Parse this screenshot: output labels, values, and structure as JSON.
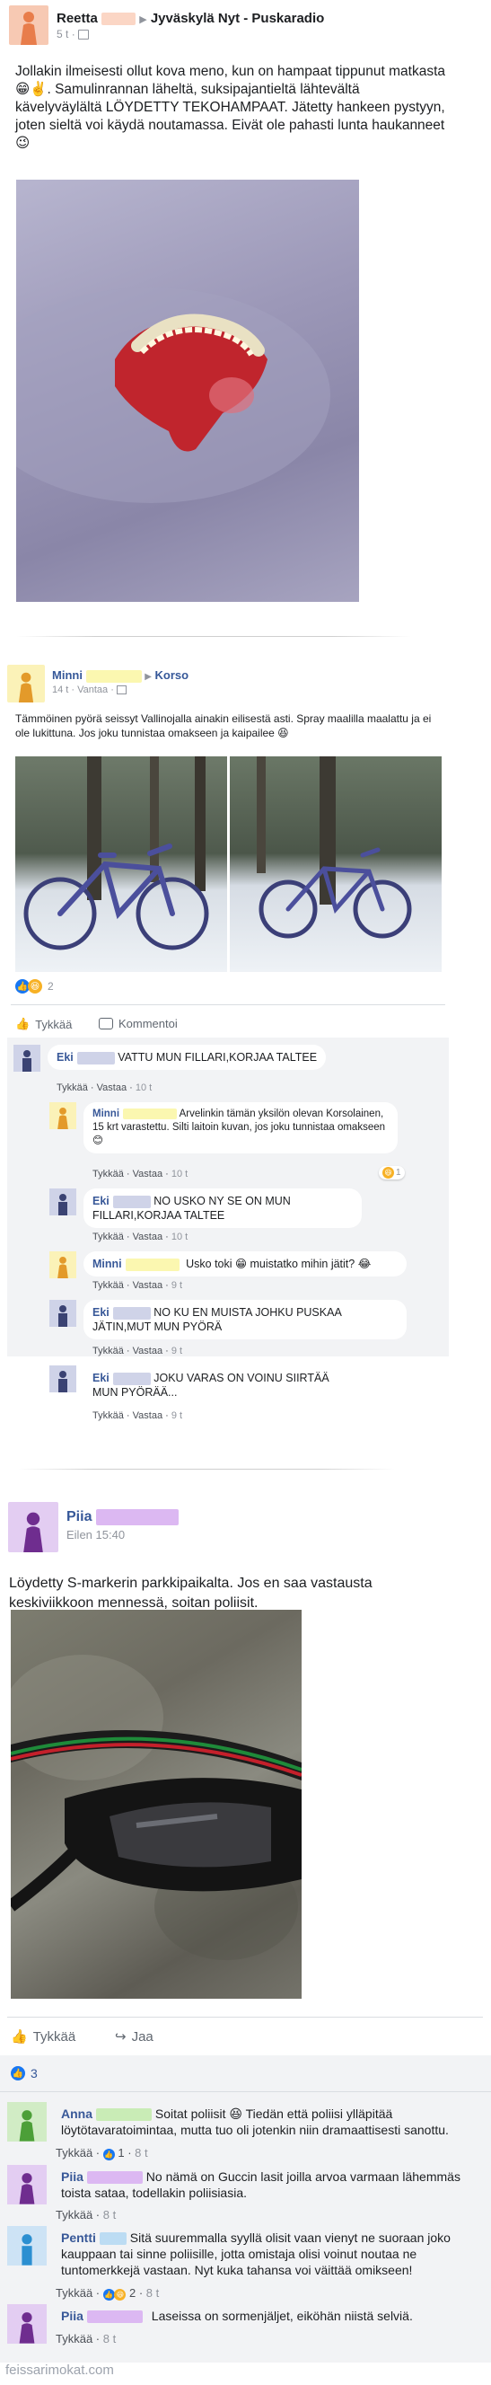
{
  "post1": {
    "author": "Reetta",
    "group": "Jyväskylä Nyt - Puskaradio",
    "time": "5 t",
    "text": "Jollakin ilmeisesti ollut kova meno, kun on hampaat tippunut matkasta😁✌️. Samulinrannan läheltä, suksipajantieltä lähtevältä kävelyväylältä LÖYDETTY TEKOHAMPAAT. Jätetty hankeen pystyyn, joten sieltä voi käydä noutamassa. Eivät ole pahasti lunta haukanneet 😉"
  },
  "post2": {
    "author": "Minni",
    "group": "Korso",
    "time": "14 t · Vantaa ·",
    "text": "Tämmöinen pyörä seissyt Vallinojalla ainakin eilisestä asti. Spray maalilla maalattu ja ei ole lukittuna. Jos joku tunnistaa omakseen ja kaipailee 😆",
    "reaction_count": "2",
    "like_label": "Tykkää",
    "comment_label": "Kommentoi",
    "comments": [
      {
        "name": "Eki",
        "text": "VATTU MUN FILLARI,KORJAA TALTEE",
        "like": "Tykkää",
        "reply": "Vastaa",
        "time": "10 t"
      },
      {
        "name": "Minni",
        "text": "Arvelinkin tämän yksilön olevan Korsolainen, 15 krt varastettu. Silti laitoin kuvan, jos joku tunnistaa omakseen 😊",
        "like": "Tykkää",
        "reply": "Vastaa",
        "time": "10 t",
        "reacts": "1"
      },
      {
        "name": "Eki",
        "text": "NO USKO NY SE ON MUN FILLARI,KORJAA TALTEE",
        "like": "Tykkää",
        "reply": "Vastaa",
        "time": "10 t"
      },
      {
        "name": "Minni",
        "text": "Usko toki 😁 muistatko mihin jätit? 😂",
        "like": "Tykkää",
        "reply": "Vastaa",
        "time": "9 t"
      },
      {
        "name": "Eki",
        "text": "NO KU EN MUISTA JOHKU PUSKAA JÄTIN,MUT MUN PYÖRÄ",
        "like": "Tykkää",
        "reply": "Vastaa",
        "time": "9 t"
      },
      {
        "name": "Eki",
        "text": "JOKU VARAS ON VOINU SIIRTÄÄ MUN PYÖRÄÄ...",
        "like": "Tykkää",
        "reply": "Vastaa",
        "time": "9 t"
      }
    ]
  },
  "post3": {
    "author": "Piia",
    "time": "Eilen 15:40",
    "text": "Löydetty S-markerin parkkipaikalta. Jos en saa vastausta keskiviikkoon mennessä, soitan poliisit.",
    "like_label": "Tykkää",
    "share_label": "Jaa",
    "reaction_count": "3",
    "comments": [
      {
        "name": "Anna",
        "text": "Soitat poliisit 😆 Tiedän että poliisi ylläpitää löytötavaratoimintaa, mutta tuo oli jotenkin niin dramaattisesti sanottu.",
        "like": "Tykkää",
        "likes": "1",
        "time": "8 t"
      },
      {
        "name": "Piia",
        "text": "No nämä on Guccin lasit joilla arvoa varmaan lähemmäs toista sataa, todellakin poliisiasia.",
        "like": "Tykkää",
        "time": "8 t"
      },
      {
        "name": "Pentti",
        "text": "Sitä suuremmalla syyllä olisit vaan vienyt ne suoraan joko kauppaan tai sinne poliisille, jotta omistaja olisi voinut noutaa ne tuntomerkkejä vastaan. Nyt kuka tahansa voi väittää omikseen!",
        "like": "Tykkää",
        "likes": "2",
        "time": "8 t"
      },
      {
        "name": "Piia",
        "text": "Laseissa on sormenjäljet, eiköhän niistä selviä.",
        "like": "Tykkää",
        "time": "8 t"
      }
    ]
  },
  "footer": "feissarimokat.com",
  "colors": {
    "link": "#365899",
    "muted": "#90949c",
    "panel": "#f2f3f5",
    "like_blue": "#1877f2"
  }
}
